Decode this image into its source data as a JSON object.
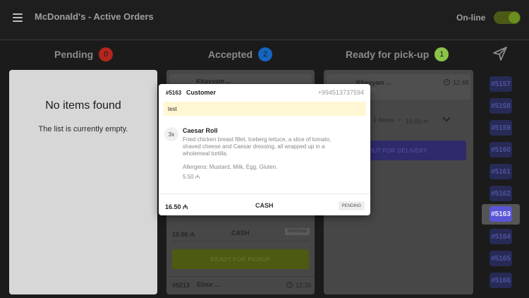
{
  "header": {
    "title": "McDonald's - Active Orders",
    "status_label": "On-line",
    "online": true
  },
  "columns": {
    "pending": {
      "title": "Pending",
      "count": "0",
      "badge_color": "#b3261e",
      "empty_title": "No items found",
      "empty_subtitle": "The list is currently empty."
    },
    "accepted": {
      "title": "Accepted",
      "count": "2",
      "badge_color": "#1565c0",
      "order_top": {
        "customer": "Khayyam ..."
      },
      "order_mid": {
        "total": "10.00 ₼",
        "payment": "CASH",
        "status": "PENDING"
      },
      "ready_button": "READY FOR PICKUP",
      "order_bottom": {
        "id": "#5213",
        "customer": "Elnur ...",
        "time": "12:30"
      }
    },
    "ready": {
      "title": "Ready for pick-up",
      "count": "1",
      "badge_color": "#8bc34a",
      "order": {
        "customer": "Khayyam ...",
        "phone": "...8410...",
        "time": "12:48",
        "items": "2 items",
        "separator": "•",
        "total": "10.00 ₼"
      },
      "action_button": "OUT FOR DELIVERY"
    }
  },
  "sidebar": {
    "orders": [
      "#5157",
      "#5158",
      "#5159",
      "#5160",
      "#5161",
      "#5162",
      "#5163",
      "#5164",
      "#5165",
      "#5166"
    ],
    "active_order": "#5163"
  },
  "modal": {
    "order_id": "#5163",
    "customer_label": "Customer",
    "phone": "+994513737594",
    "note": "test",
    "item": {
      "qty": "3x",
      "name": "Caesar Roll",
      "description": "Fried chicken breast fillet, Iceberg lettuce, a slice of tomato, shaved cheese and Caesar dressing, all wrapped up in a wholemeal tortilla.",
      "allergens": "Allergens: Mustard, Milk, Egg, Gluten.",
      "price": "5.50 ₼"
    },
    "footer": {
      "total": "16.50 ₼",
      "payment": "CASH",
      "status": "PENDING"
    }
  },
  "colors": {
    "accent": "#5a55d6",
    "pending_badge": "#b3261e",
    "accepted_badge": "#1565c0",
    "ready_badge": "#8bc34a"
  }
}
